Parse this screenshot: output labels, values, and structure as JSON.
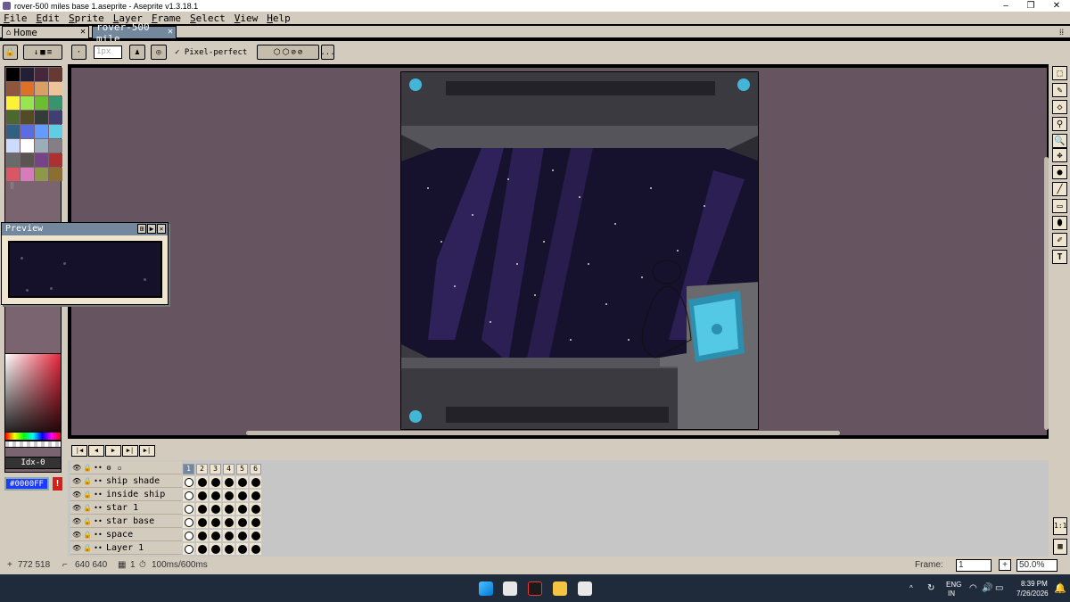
{
  "window": {
    "title": "rover-500 miles base 1.aseprite - Aseprite v1.3.18.1",
    "minimize": "–",
    "maximize": "❐",
    "close": "✕"
  },
  "menu": [
    "File",
    "Edit",
    "Sprite",
    "Layer",
    "Frame",
    "Select",
    "View",
    "Help"
  ],
  "tabs": {
    "home": "Home",
    "doc": "rover-500 mile",
    "close": "✕"
  },
  "toolbar": {
    "brush_size": "1px",
    "pixel_perfect": "Pixel-perfect",
    "more": "..."
  },
  "preview": {
    "title": "Preview"
  },
  "color": {
    "index": "Idx-0",
    "hex": "#0000FF",
    "warn": "!",
    "palette": [
      "#000000",
      "#222034",
      "#45283c",
      "#663931",
      "#8f563b",
      "#df7126",
      "#d9a066",
      "#eec39a",
      "#fbf236",
      "#99e550",
      "#6abe30",
      "#37946e",
      "#4b692f",
      "#524b24",
      "#323c39",
      "#3f3f74",
      "#306082",
      "#5b6ee1",
      "#639bff",
      "#5fcde4",
      "#cbdbfc",
      "#ffffff",
      "#9badb7",
      "#847e87",
      "#696a6a",
      "#595652",
      "#76428a",
      "#ac3232",
      "#d95763",
      "#d77bba",
      "#8f974a",
      "#8a6f30"
    ]
  },
  "timeline": {
    "frames": [
      "1",
      "2",
      "3",
      "4",
      "5",
      "6"
    ],
    "layers": [
      "ship shade",
      "inside ship",
      "star 1",
      "star base",
      "space",
      "Layer 1"
    ]
  },
  "status": {
    "coords": "772 518",
    "size": "640 640",
    "frame_info": "1",
    "duration": "100ms/600ms",
    "frame_label": "Frame:",
    "frame_value": "1",
    "zoom": "50.0%"
  },
  "taskbar": {
    "lang": "ENG",
    "region": "IN",
    "time": "8:39 PM",
    "date": "7/26/2026"
  },
  "rightside": {
    "ratio": "1:1"
  }
}
